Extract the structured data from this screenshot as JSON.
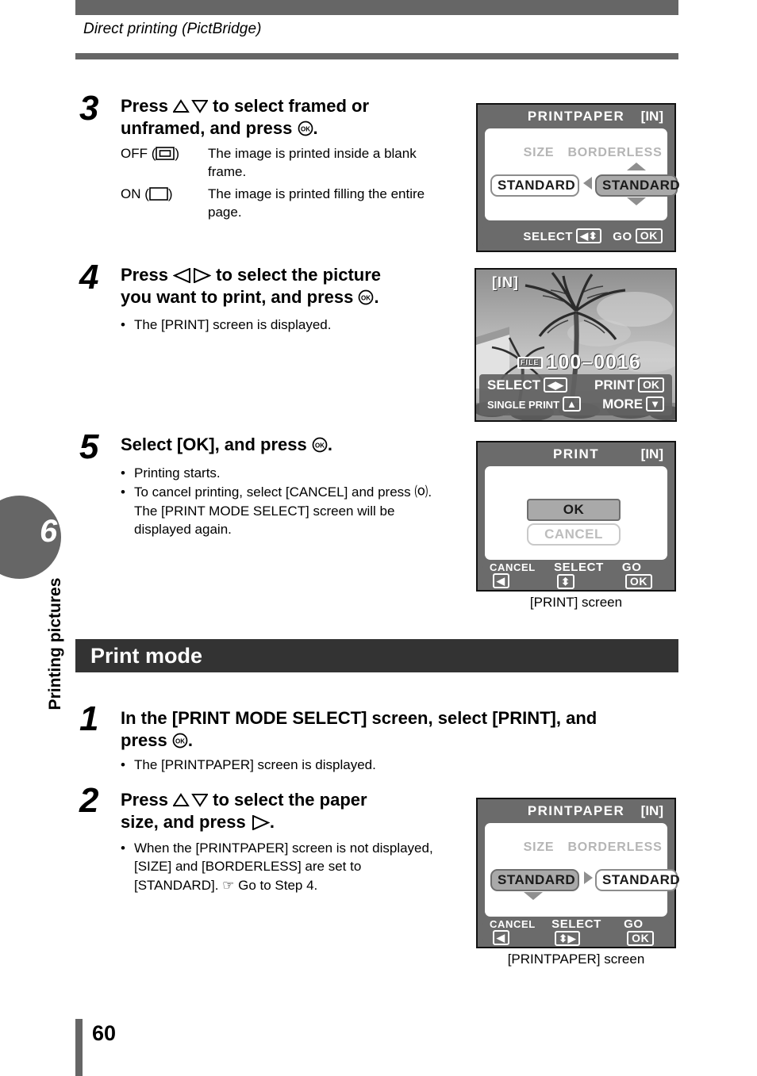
{
  "header": {
    "running_title": "Direct printing (PictBridge)"
  },
  "chapter": {
    "number": "6",
    "label": "Printing pictures"
  },
  "page_number": "60",
  "section": {
    "heading": "Print mode"
  },
  "steps": [
    {
      "number": "3",
      "title_line1": "Press  △▽  to select framed or",
      "title_line2": "unframed, and press  ⒪.",
      "definitions": [
        {
          "key": "OFF (▣)",
          "value": "The image is printed inside a blank frame."
        },
        {
          "key": "ON (□)",
          "value": "The image is printed filling the entire page."
        }
      ]
    },
    {
      "number": "4",
      "title_line1": "Press  ◁▷  to select the picture",
      "title_line2": "you want to print, and press  ⒪.",
      "bullets": [
        "The [PRINT] screen is displayed."
      ]
    },
    {
      "number": "5",
      "title_line1": "Select [OK], and press  ⒪.",
      "bullets": [
        "Printing starts.",
        "To cancel printing, select [CANCEL] and press ⒪. The [PRINT MODE SELECT] screen will be displayed again."
      ]
    },
    {
      "number": "1",
      "title_line1": "In the [PRINT MODE SELECT] screen, select [PRINT], and",
      "title_line2": "press  ⒪.",
      "bullets": [
        "The [PRINTPAPER] screen is displayed."
      ]
    },
    {
      "number": "2",
      "title_line1": "Press  △▽  to select the paper",
      "title_line2": "size, and press  ▷.",
      "bullets": [
        "When the [PRINTPAPER] screen is not displayed, [SIZE] and [BORDERLESS] are set to [STANDARD].  ☞  Go to Step 4."
      ]
    }
  ],
  "screens": {
    "printpaper_borderless": {
      "title": "PRINTPAPER",
      "media": "[IN]",
      "col1_label": "SIZE",
      "col2_label": "BORDERLESS",
      "col1_value": "STANDARD",
      "col2_value": "STANDARD",
      "selected_column": "BORDERLESS",
      "footer": [
        {
          "label": "SELECT",
          "key": "◀⬍"
        },
        {
          "label": "GO",
          "key": "OK"
        }
      ]
    },
    "picture_select": {
      "media": "[IN]",
      "file_tag": "FILE",
      "file_number": "100–0016",
      "footer": [
        {
          "label": "SELECT",
          "key": "◀▶"
        },
        {
          "label": "PRINT",
          "key": "OK"
        },
        {
          "label": "SINGLE PRINT",
          "key": "▲"
        },
        {
          "label": "MORE",
          "key": "▼"
        }
      ]
    },
    "print_confirm": {
      "title": "PRINT",
      "media": "[IN]",
      "options": [
        {
          "label": "OK",
          "state": "selected"
        },
        {
          "label": "CANCEL",
          "state": "dimmed"
        }
      ],
      "footer": [
        {
          "label": "CANCEL",
          "key": "◀"
        },
        {
          "label": "SELECT",
          "key": "⬍"
        },
        {
          "label": "GO",
          "key": "OK"
        }
      ],
      "caption": "[PRINT] screen"
    },
    "printpaper_size": {
      "title": "PRINTPAPER",
      "media": "[IN]",
      "col1_label": "SIZE",
      "col2_label": "BORDERLESS",
      "col1_value": "STANDARD",
      "col2_value": "STANDARD",
      "selected_column": "SIZE",
      "footer": [
        {
          "label": "CANCEL",
          "key": "◀"
        },
        {
          "label": "SELECT",
          "key": "⬍▶"
        },
        {
          "label": "GO",
          "key": "OK"
        }
      ],
      "caption": "[PRINTPAPER] screen"
    }
  },
  "colors": {
    "bar_gray": "#666666",
    "section_dark": "#333333",
    "lcd_gray": "#6b6b6b",
    "pill_selected": "#a9a9a9"
  }
}
